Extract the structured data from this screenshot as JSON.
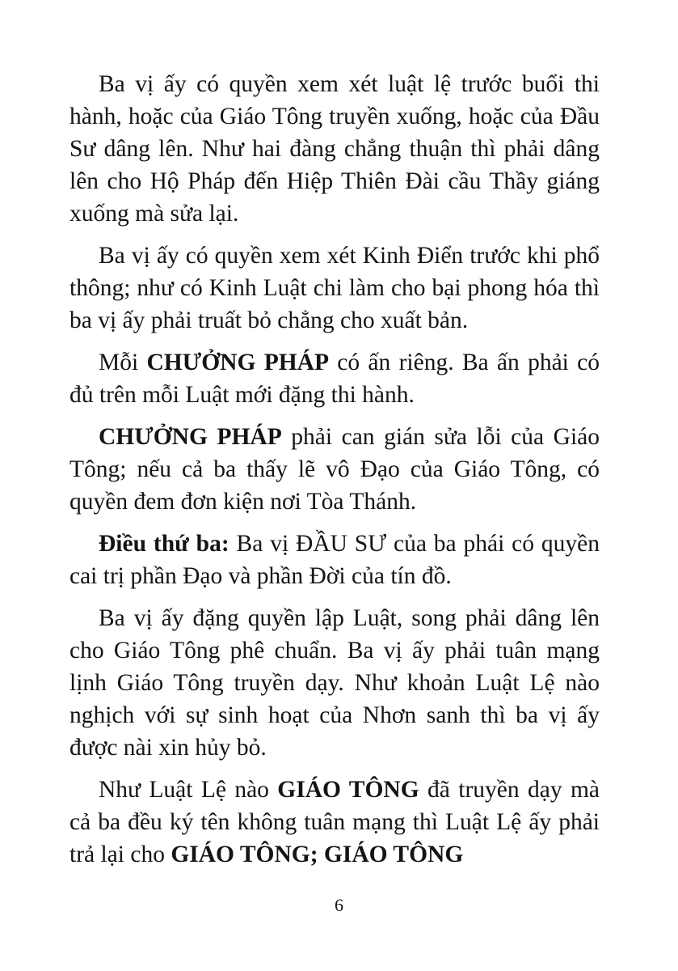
{
  "paragraphs": [
    [
      {
        "t": "Ba vị ấy có quyền xem xét luật lệ trước buổi thi hành, hoặc của Giáo Tông truyền xuống, hoặc của Đầu Sư dâng lên. Như hai đàng chẳng thuận thì phải dâng lên cho Hộ Pháp đến Hiệp Thiên Đài cầu Thầy giáng xuống mà sửa lại."
      }
    ],
    [
      {
        "t": "Ba vị ấy có quyền xem xét Kinh Điển trước khi phổ thông; như có Kinh Luật chi làm cho bại phong hóa thì ba vị ấy phải truất bỏ chẳng cho xuất bản."
      }
    ],
    [
      {
        "t": "Mỗi "
      },
      {
        "t": "CHƯỞNG PHÁP",
        "b": true
      },
      {
        "t": " có ấn riêng. Ba ấn phải có đủ trên mỗi Luật mới đặng thi hành."
      }
    ],
    [
      {
        "t": "CHƯỞNG PHÁP",
        "b": true
      },
      {
        "t": " phải can gián sửa lỗi của Giáo Tông; nếu cả ba thấy lẽ vô Đạo của Giáo Tông, có quyền đem đơn kiện nơi Tòa Thánh."
      }
    ],
    [
      {
        "t": "Điều thứ ba:",
        "b": true
      },
      {
        "t": " Ba vị ĐẦU SƯ của ba phái có quyền cai trị phần Đạo và phần Đời của tín đồ."
      }
    ],
    [
      {
        "t": "Ba vị ấy đặng quyền lập Luật, song phải dâng lên cho Giáo Tông phê chuẩn. Ba vị ấy phải tuân mạng lịnh Giáo Tông truyền dạy. Như khoản Luật Lệ nào nghịch với sự sinh hoạt của Nhơn sanh thì ba vị ấy được nài xin hủy bỏ."
      }
    ],
    [
      {
        "t": "Như Luật Lệ nào "
      },
      {
        "t": "GIÁO TÔNG",
        "b": true
      },
      {
        "t": " đã truyền dạy mà cả ba đều ký tên không tuân mạng thì Luật Lệ ấy phải trả lại cho "
      },
      {
        "t": "GIÁO TÔNG; GIÁO TÔNG",
        "b": true
      }
    ]
  ],
  "page_number": "6"
}
